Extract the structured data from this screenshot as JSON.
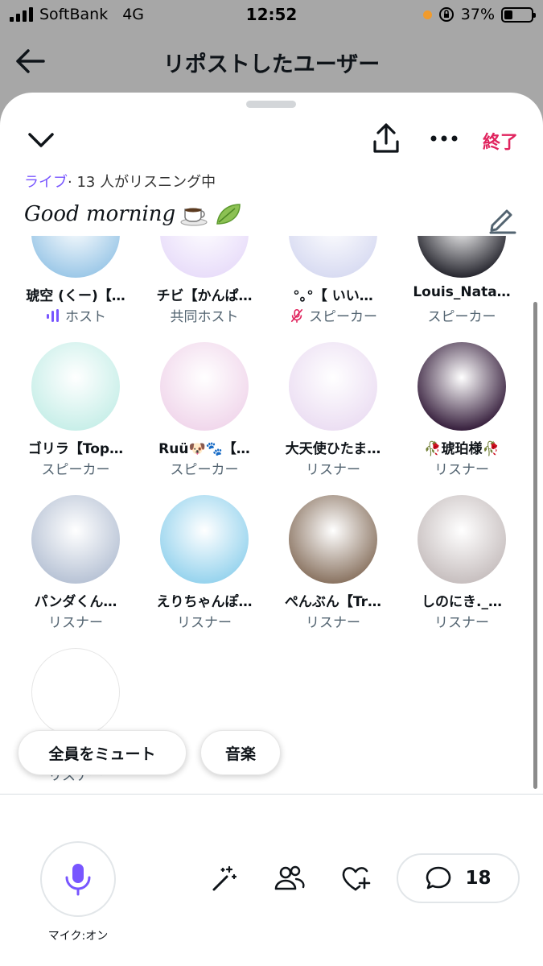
{
  "status_bar": {
    "carrier": "SoftBank",
    "network": "4G",
    "time": "12:52",
    "battery": "37%"
  },
  "header": {
    "title": "リポストしたユーザー",
    "back_icon": "arrow-left-icon"
  },
  "sheet": {
    "end_label": "終了",
    "live_label": "ライブ",
    "listening_text": "· 13 人がリスニング中",
    "space_title": "Good morning",
    "title_emojis": [
      "☕",
      "🍃"
    ]
  },
  "participants": [
    {
      "name": "琥空 (くー)【…",
      "role": "ホスト",
      "role_icon": "speaking-bars-icon",
      "color": "#9ec9e8"
    },
    {
      "name": "チビ【かんぱ…",
      "role": "共同ホスト",
      "role_icon": "",
      "color": "#e9defa"
    },
    {
      "name": "°｡°【 いい…",
      "role": "スピーカー",
      "role_icon": "mic-muted-icon",
      "color": "#d9dcf2"
    },
    {
      "name": "Louis_Nata…",
      "role": "スピーカー",
      "role_icon": "",
      "color": "#2b2b33"
    },
    {
      "name": "ゴリラ【Top…",
      "role": "スピーカー",
      "role_icon": "",
      "color": "#c9efe9"
    },
    {
      "name": "Ruü🐶🐾【…",
      "role": "スピーカー",
      "role_icon": "",
      "color": "#f1d8ec"
    },
    {
      "name": "大天使ひたま…",
      "role": "リスナー",
      "role_icon": "",
      "color": "#ecdff3"
    },
    {
      "name": "🥀琥珀様🥀",
      "role": "リスナー",
      "role_icon": "",
      "color": "#3a2340"
    },
    {
      "name": "パンダくん…",
      "role": "リスナー",
      "role_icon": "",
      "color": "#b9c4d6"
    },
    {
      "name": "えりちゃんぽ…",
      "role": "リスナー",
      "role_icon": "",
      "color": "#98d4ee"
    },
    {
      "name": "ぺんぶん【Tr…",
      "role": "リスナー",
      "role_icon": "",
      "color": "#8c7664"
    },
    {
      "name": "しのにき._…",
      "role": "リスナー",
      "role_icon": "",
      "color": "#c8c0c0"
    },
    {
      "name": "",
      "role": "リスナー",
      "role_icon": "",
      "color": "#ffffff"
    }
  ],
  "actions": {
    "mute_all": "全員をミュート",
    "music": "音楽",
    "mic_label": "マイク:オン",
    "comment_count": "18"
  },
  "colors": {
    "accent": "#7856ff",
    "end": "#e0245e",
    "muted_mic": "#e0245e"
  }
}
